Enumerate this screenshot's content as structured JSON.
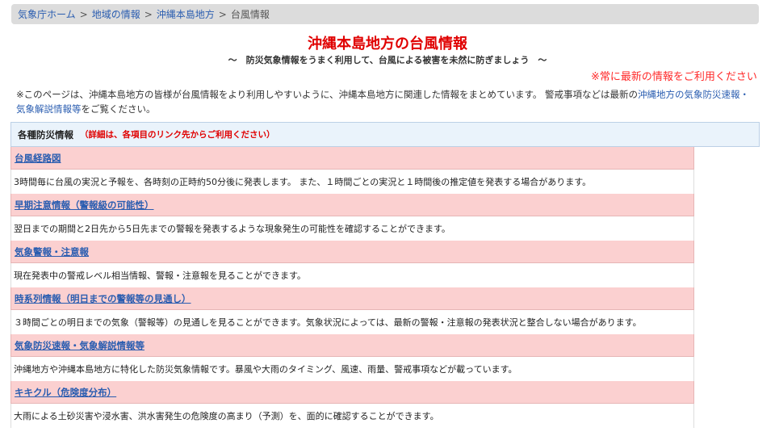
{
  "breadcrumb": {
    "items": [
      "気象庁ホーム",
      "地域の情報",
      "沖縄本島地方"
    ],
    "current": "台風情報",
    "separator": ">"
  },
  "title": "沖縄本島地方の台風情報",
  "subtitle": "～　防災気象情報をうまく利用して、台風による被害を未然に防ぎましょう　～",
  "notice": "※常に最新の情報をご利用ください",
  "intro": {
    "text": "※このページは、沖縄本島地方の皆様が台風情報をより利用しやすいように、沖縄本島地方に関連した情報をまとめています。 警戒事項などは最新の",
    "link": "沖縄地方の気象防災速報・気象解説情報等",
    "suffix": "をご覧ください。"
  },
  "panel": {
    "header": "各種防災情報",
    "note": "（詳細は、各項目のリンク先からご利用ください）",
    "items": [
      {
        "title": "台風経路図",
        "desc": "3時間毎に台風の実況と予報を、各時刻の正時約50分後に発表します。 また、１時間ごとの実況と１時間後の推定値を発表する場合があります。"
      },
      {
        "title": "早期注意情報（警報級の可能性）",
        "desc": "翌日までの期間と2日先から5日先までの警報を発表するような現象発生の可能性を確認することができます。"
      },
      {
        "title": "気象警報・注意報",
        "desc": "現在発表中の警戒レベル相当情報、警報・注意報を見ることができます。"
      },
      {
        "title": "時系列情報（明日までの警報等の見通し）",
        "desc": "３時間ごとの明日までの気象（警報等）の見通しを見ることができます。気象状況によっては、最新の警報・注意報の発表状況と整合しない場合があります。"
      },
      {
        "title": "気象防災速報・気象解説情報等",
        "desc": "沖縄地方や沖縄本島地方に特化した防災気象情報です。暴風や大雨のタイミング、風速、雨量、警戒事項などが載っています。"
      },
      {
        "title": "キキクル（危険度分布）",
        "desc": "大雨による土砂災害や浸水害、洪水害発生の危険度の高まり（予測）を、面的に確認することができます。"
      }
    ]
  }
}
